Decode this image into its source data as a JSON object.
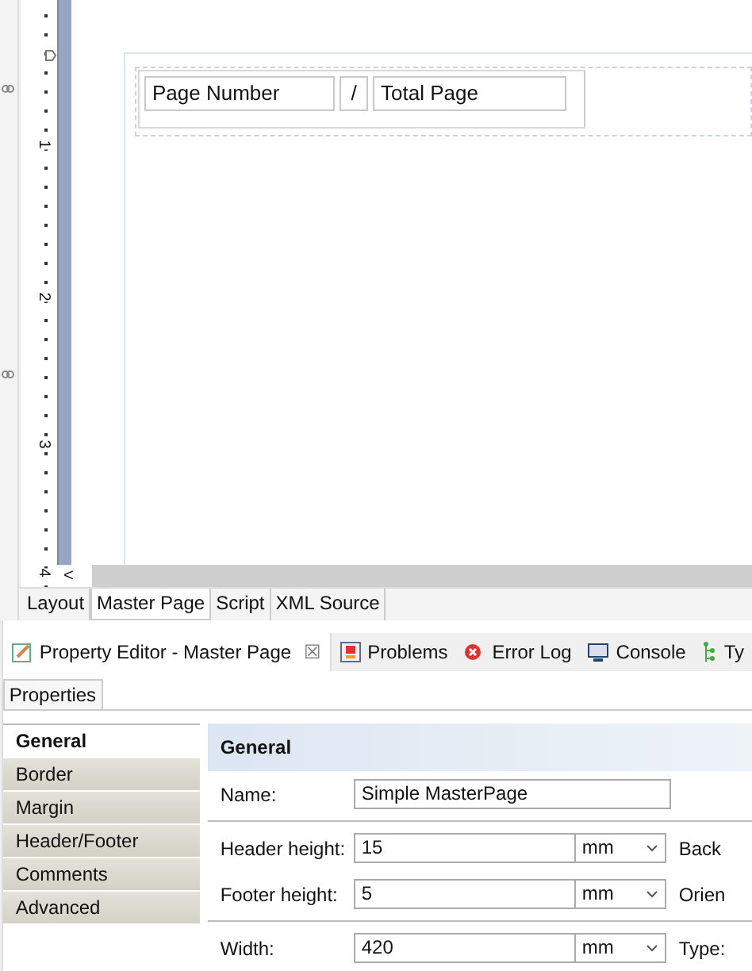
{
  "ruler": {
    "marks": [
      "1",
      "2",
      "3",
      "4"
    ]
  },
  "scroll_arrow": "<",
  "master_page": {
    "cells": [
      "Page Number",
      "/",
      "Total Page"
    ]
  },
  "editor_tabs": [
    {
      "label": "Layout",
      "selected": false
    },
    {
      "label": "Master Page",
      "selected": true
    },
    {
      "label": "Script",
      "selected": false
    },
    {
      "label": "XML Source",
      "selected": false
    }
  ],
  "view_tabs": [
    {
      "label": "Property Editor - Master Page",
      "kind": "editor",
      "selected": true,
      "close": "☒"
    },
    {
      "label": "Problems",
      "kind": "problems",
      "selected": false
    },
    {
      "label": "Error Log",
      "kind": "log",
      "selected": false
    },
    {
      "label": "Console",
      "kind": "console",
      "selected": false
    },
    {
      "label": "Ty",
      "kind": "tree",
      "selected": false
    }
  ],
  "properties_tab": "Properties",
  "categories": [
    {
      "label": "General",
      "selected": true
    },
    {
      "label": "Border",
      "selected": false
    },
    {
      "label": "Margin",
      "selected": false
    },
    {
      "label": "Header/Footer",
      "selected": false
    },
    {
      "label": "Comments",
      "selected": false
    },
    {
      "label": "Advanced",
      "selected": false
    }
  ],
  "section_title": "General",
  "name_field": {
    "label": "Name:",
    "value": "Simple MasterPage"
  },
  "rows": [
    {
      "label": "Header height:",
      "value": "15",
      "unit": "mm",
      "side_label": "Back",
      "divider_after": false
    },
    {
      "label": "Footer height:",
      "value": "5",
      "unit": "mm",
      "side_label": "Orien",
      "divider_after": true
    },
    {
      "label": "Width:",
      "value": "420",
      "unit": "mm",
      "side_label": "Type:",
      "divider_after": false
    }
  ]
}
